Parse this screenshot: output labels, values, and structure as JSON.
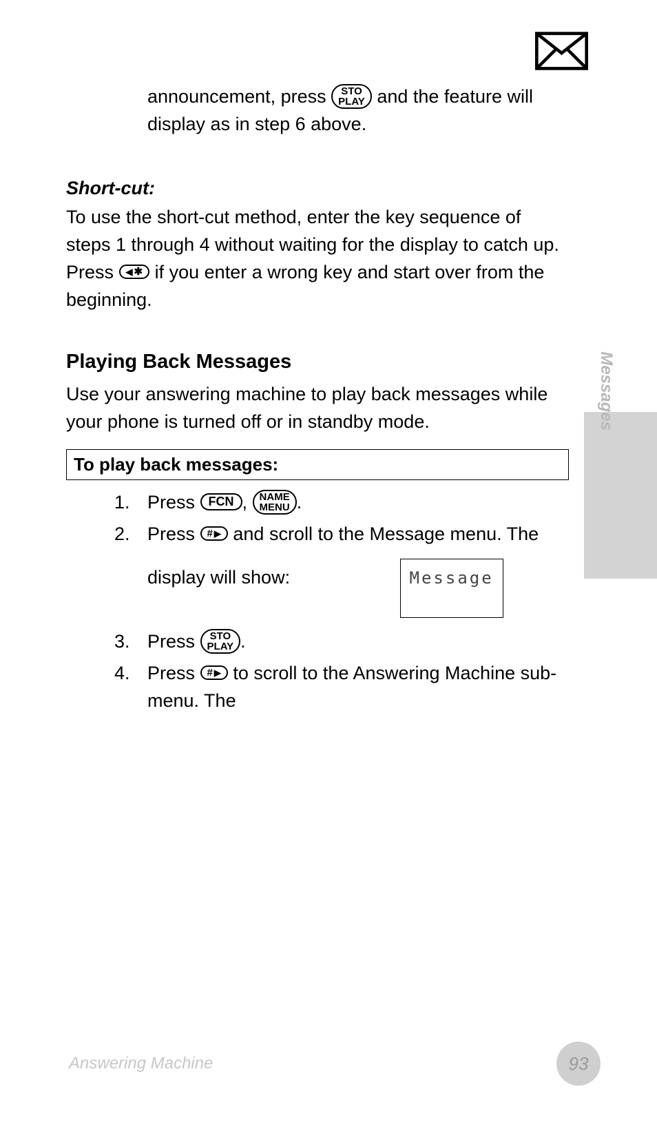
{
  "icons": {
    "mail": "mail-icon"
  },
  "intro_before": "announcement, press ",
  "intro_key_top": "STO",
  "intro_key_bottom": "PLAY",
  "intro_after": " and the feature will display as in step 6 above.",
  "shortcut_label": "Short-cut:",
  "shortcut_text_before": "To use the short-cut method, enter the key sequence of steps 1 through 4 without waiting for the display to catch up. Press ",
  "shortcut_key_arrow": "✱",
  "shortcut_text_after": " if you enter a wrong key and start over from the beginning.",
  "section_title": "Playing Back Messages",
  "section_body": "Use your answering machine to play back messages while your phone is turned off or in standby mode.",
  "steps_box_title": "To play back messages:",
  "steps": [
    {
      "before": "Press ",
      "key1": "FCN",
      "sep": ", ",
      "key2_top": "NAME",
      "key2_bottom": "MENU",
      "after": "."
    },
    {
      "before": "Press ",
      "key_hash": "#",
      "after": " and scroll to the Message menu. The display will show:"
    },
    {
      "before": "Press ",
      "key_top": "STO",
      "key_bottom": "PLAY",
      "after": "."
    },
    {
      "before": "Press ",
      "key_hash": "#",
      "after": " to scroll to the Answering Machine sub-menu. The"
    }
  ],
  "lcd": "Message",
  "side_tab": "Messages",
  "footer": "Answering Machine",
  "page_number": "93"
}
